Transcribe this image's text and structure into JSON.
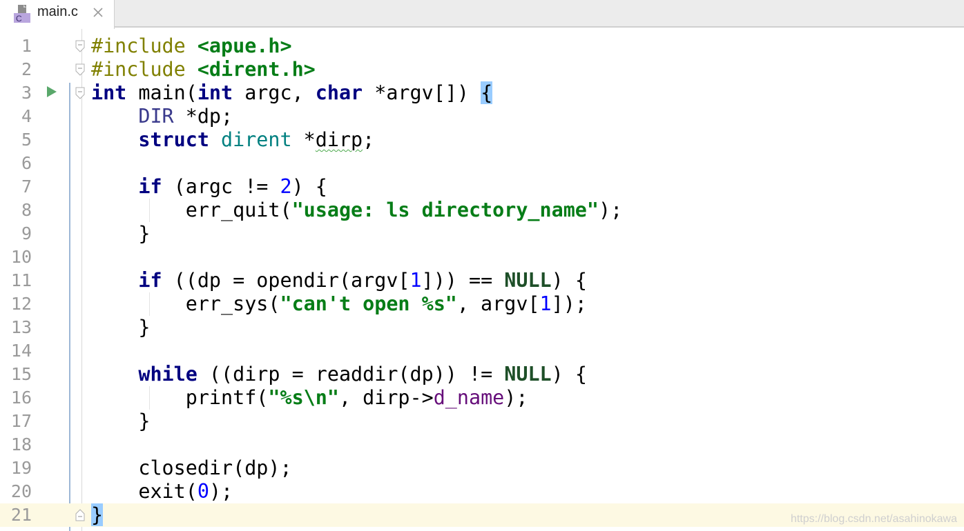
{
  "tab": {
    "title": "main.c",
    "icon": "c-file-icon",
    "close_icon": "close-icon"
  },
  "editor": {
    "lines": [
      {
        "n": "1",
        "html": "<span class='pp'>#include</span> <span class='hdr'>&lt;apue.h&gt;</span>"
      },
      {
        "n": "2",
        "html": "<span class='pp'>#include</span> <span class='hdr'>&lt;dirent.h&gt;</span>"
      },
      {
        "n": "3",
        "html": "<span class='kw'>int</span> main(<span class='kw'>int</span> argc, <span class='kw'>char</span> *argv[]) <span class='brace-hl'>{</span>"
      },
      {
        "n": "4",
        "html": "    <span class='typ'>DIR</span> *dp;"
      },
      {
        "n": "5",
        "html": "    <span class='kw'>struct</span> <span class='st'>dirent</span> *<span class='squig'>dirp</span>;"
      },
      {
        "n": "6",
        "html": ""
      },
      {
        "n": "7",
        "html": "    <span class='kw'>if</span> (argc != <span class='num'>2</span>) {"
      },
      {
        "n": "8",
        "html": "        err_quit(<span class='str'>\"usage: ls directory_name\"</span>);"
      },
      {
        "n": "9",
        "html": "    }"
      },
      {
        "n": "10",
        "html": ""
      },
      {
        "n": "11",
        "html": "    <span class='kw'>if</span> ((dp = opendir(argv[<span class='num'>1</span>])) == <span class='mac'>NULL</span>) {"
      },
      {
        "n": "12",
        "html": "        err_sys(<span class='str'>\"can't open %s\"</span>, argv[<span class='num'>1</span>]);"
      },
      {
        "n": "13",
        "html": "    }"
      },
      {
        "n": "14",
        "html": ""
      },
      {
        "n": "15",
        "html": "    <span class='kw'>while</span> ((dirp = readdir(dp)) != <span class='mac'>NULL</span>) {"
      },
      {
        "n": "16",
        "html": "        printf(<span class='str'>\"%s\\n\"</span>, dirp-&gt;<span class='fld'>d_name</span>);"
      },
      {
        "n": "17",
        "html": "    }"
      },
      {
        "n": "18",
        "html": ""
      },
      {
        "n": "19",
        "html": "    closedir(dp);"
      },
      {
        "n": "20",
        "html": "    exit(<span class='num'>0</span>);"
      },
      {
        "n": "21",
        "html": "<span class='brace-hl'>}</span>"
      }
    ],
    "current_line": "21"
  },
  "watermark": "https://blog.csdn.net/asahinokawa",
  "colors": {
    "keyword": "#000080",
    "string": "#067d17",
    "number": "#0000ff",
    "preprocessor": "#808000",
    "current_line_bg": "#fdf9e3",
    "brace_match": "#99ccff"
  }
}
